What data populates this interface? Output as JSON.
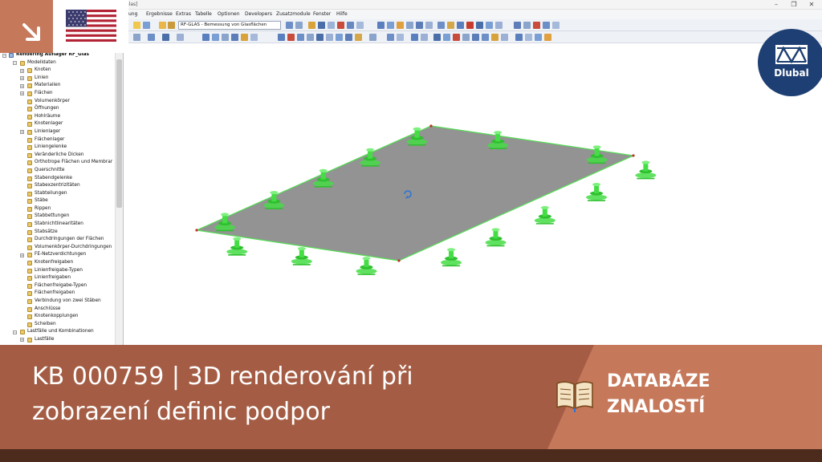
{
  "window": {
    "title_fragment": "Glas]",
    "controls": [
      "–",
      "❐",
      "✕"
    ]
  },
  "menu": {
    "items": [
      "ung",
      "Ergebnisse",
      "Extras",
      "Tabelle",
      "Optionen",
      "Developers",
      "Zusatzmodule",
      "Fenster",
      "Hilfe"
    ]
  },
  "toolbar": {
    "module_combo": "RF-GLAS - Bemessung von Glasflächen"
  },
  "navigator": {
    "root": "Rendering Auflager RF_Glas",
    "items": [
      {
        "label": "Modelldaten",
        "level": 1,
        "expander": "−"
      },
      {
        "label": "Knoten",
        "level": 2,
        "expander": "+"
      },
      {
        "label": "Linien",
        "level": 2,
        "expander": "+"
      },
      {
        "label": "Materialien",
        "level": 2,
        "expander": "+"
      },
      {
        "label": "Flächen",
        "level": 2,
        "expander": "+"
      },
      {
        "label": "Volumenkörper",
        "level": 2,
        "expander": ""
      },
      {
        "label": "Öffnungen",
        "level": 2,
        "expander": ""
      },
      {
        "label": "Hohlräume",
        "level": 2,
        "expander": ""
      },
      {
        "label": "Knotenlager",
        "level": 2,
        "expander": ""
      },
      {
        "label": "Linienlager",
        "level": 2,
        "expander": "+"
      },
      {
        "label": "Flächenlager",
        "level": 2,
        "expander": ""
      },
      {
        "label": "Liniengelenke",
        "level": 2,
        "expander": ""
      },
      {
        "label": "Veränderliche Dicken",
        "level": 2,
        "expander": ""
      },
      {
        "label": "Orthotrope Flächen und Membrar",
        "level": 2,
        "expander": ""
      },
      {
        "label": "Querschnitte",
        "level": 2,
        "expander": ""
      },
      {
        "label": "Stabendgelenke",
        "level": 2,
        "expander": ""
      },
      {
        "label": "Stabexzentrizitäten",
        "level": 2,
        "expander": ""
      },
      {
        "label": "Stabteilungen",
        "level": 2,
        "expander": ""
      },
      {
        "label": "Stäbe",
        "level": 2,
        "expander": ""
      },
      {
        "label": "Rippen",
        "level": 2,
        "expander": ""
      },
      {
        "label": "Stabbettungen",
        "level": 2,
        "expander": ""
      },
      {
        "label": "Stabnichtlinearitäten",
        "level": 2,
        "expander": ""
      },
      {
        "label": "Stabsätze",
        "level": 2,
        "expander": ""
      },
      {
        "label": "Durchdringungen der Flächen",
        "level": 2,
        "expander": ""
      },
      {
        "label": "Volumenkörper-Durchdringungen",
        "level": 2,
        "expander": ""
      },
      {
        "label": "FE-Netzverdichtungen",
        "level": 2,
        "expander": "+"
      },
      {
        "label": "Knotenfreigaben",
        "level": 2,
        "expander": ""
      },
      {
        "label": "Linienfreigabe-Typen",
        "level": 2,
        "expander": ""
      },
      {
        "label": "Linienfreigaben",
        "level": 2,
        "expander": ""
      },
      {
        "label": "Flächenfreigabe-Typen",
        "level": 2,
        "expander": ""
      },
      {
        "label": "Flächenfreigaben",
        "level": 2,
        "expander": ""
      },
      {
        "label": "Verbindung von zwei Stäben",
        "level": 2,
        "expander": ""
      },
      {
        "label": "Anschlüsse",
        "level": 2,
        "expander": ""
      },
      {
        "label": "Knotenkopplungen",
        "level": 2,
        "expander": ""
      },
      {
        "label": "Scheiben",
        "level": 2,
        "expander": ""
      },
      {
        "label": "Lastfälle und Kombinationen",
        "level": 1,
        "expander": "−"
      },
      {
        "label": "Lastfälle",
        "level": 2,
        "expander": "+"
      }
    ]
  },
  "brand": {
    "logo_text": "Dlubal"
  },
  "banner": {
    "title_line1": "KB 000759 | 3D renderování při",
    "title_line2": "zobrazení definic podpor",
    "kb_line1": "DATABÁZE",
    "kb_line2": "ZNALOSTÍ"
  },
  "colors": {
    "banner": "#a45d44",
    "banner_light": "#c6785a",
    "dlubal_blue": "#1e3f73",
    "support_green": "#44dd44",
    "plate_gray": "#8a8a8a"
  }
}
